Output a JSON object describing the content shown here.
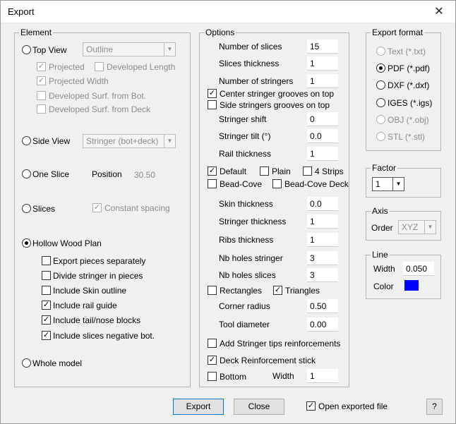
{
  "window": {
    "title": "Export",
    "close_glyph": "✕"
  },
  "element": {
    "title": "Element",
    "top_view": {
      "label": "Top View",
      "combo": "Outline"
    },
    "projected": "Projected",
    "developed_length": "Developed Length",
    "projected_width": "Projected Width",
    "dev_surf_bot": "Developed Surf. from Bot.",
    "dev_surf_deck": "Developed Surf. from Deck",
    "side_view": {
      "label": "Side View",
      "combo": "Stringer (bot+deck)"
    },
    "one_slice": {
      "label": "One Slice",
      "position_label": "Position",
      "position_value": "30.50"
    },
    "slices": {
      "label": "Slices",
      "constant_spacing": "Constant spacing"
    },
    "hollow_wood_plan": "Hollow Wood Plan",
    "hollow_options": [
      {
        "label": "Export pieces separately",
        "checked": false
      },
      {
        "label": "Divide stringer in pieces",
        "checked": false
      },
      {
        "label": "Include Skin outline",
        "checked": false
      },
      {
        "label": "Include rail guide",
        "checked": true
      },
      {
        "label": "Include tail/nose blocks",
        "checked": true
      },
      {
        "label": "Include slices negative bot.",
        "checked": true
      }
    ],
    "whole_model": "Whole model"
  },
  "options": {
    "title": "Options",
    "num_slices": {
      "label": "Number of slices",
      "value": "15"
    },
    "slices_thickness": {
      "label": "Slices thickness",
      "value": "1"
    },
    "num_stringers": {
      "label": "Number of stringers",
      "value": "1"
    },
    "center_grooves": {
      "label": "Center stringer grooves on top",
      "checked": true
    },
    "side_grooves": {
      "label": "Side stringers grooves on top",
      "checked": false
    },
    "stringer_shift": {
      "label": "Stringer shift",
      "value": "0"
    },
    "stringer_tilt": {
      "label": "Stringer tilt (°)",
      "value": "0.0"
    },
    "rail_thickness": {
      "label": "Rail thickness",
      "value": "1"
    },
    "default": {
      "label": "Default",
      "checked": true
    },
    "plain": {
      "label": "Plain",
      "checked": false
    },
    "four_strips": {
      "label": "4 Strips",
      "checked": false
    },
    "bead_cove": {
      "label": "Bead-Cove",
      "checked": false
    },
    "bead_cove_deck": {
      "label": "Bead-Cove Deck",
      "checked": false
    },
    "skin_thickness": {
      "label": "Skin thickness",
      "value": "0.0"
    },
    "stringer_thickness": {
      "label": "Stringer thickness",
      "value": "1"
    },
    "ribs_thickness": {
      "label": "Ribs thickness",
      "value": "1"
    },
    "nb_holes_stringer": {
      "label": "Nb holes stringer",
      "value": "3"
    },
    "nb_holes_slices": {
      "label": "Nb holes slices",
      "value": "3"
    },
    "rectangles": {
      "label": "Rectangles",
      "checked": false
    },
    "triangles": {
      "label": "Triangles",
      "checked": true
    },
    "corner_radius": {
      "label": "Corner radius",
      "value": "0.50"
    },
    "tool_diameter": {
      "label": "Tool diameter",
      "value": "0.00"
    },
    "tips_reinforcements": {
      "label": "Add Stringer tips reinforcements",
      "checked": false
    },
    "deck_reinforcement": {
      "label": "Deck Reinforcement stick",
      "checked": true
    },
    "bottom": {
      "label": "Bottom",
      "checked": false
    },
    "width": {
      "label": "Width",
      "value": "1"
    }
  },
  "export_format": {
    "title": "Export format",
    "formats": [
      {
        "label": "Text (*.txt)",
        "enabled": false,
        "selected": false
      },
      {
        "label": "PDF (*.pdf)",
        "enabled": true,
        "selected": true
      },
      {
        "label": "DXF (*.dxf)",
        "enabled": true,
        "selected": false
      },
      {
        "label": "IGES (*.igs)",
        "enabled": true,
        "selected": false
      },
      {
        "label": "OBJ (*.obj)",
        "enabled": false,
        "selected": false
      },
      {
        "label": "STL (*.stl)",
        "enabled": false,
        "selected": false
      }
    ]
  },
  "factor": {
    "title": "Factor",
    "value": "1"
  },
  "axis": {
    "title": "Axis",
    "order_label": "Order",
    "order_value": "XYZ"
  },
  "line": {
    "title": "Line",
    "width_label": "Width",
    "width_value": "0.050",
    "color_label": "Color",
    "color": "#0000ff"
  },
  "footer": {
    "export": "Export",
    "close": "Close",
    "open_exported": "Open exported file",
    "open_checked": true,
    "help": "?"
  }
}
